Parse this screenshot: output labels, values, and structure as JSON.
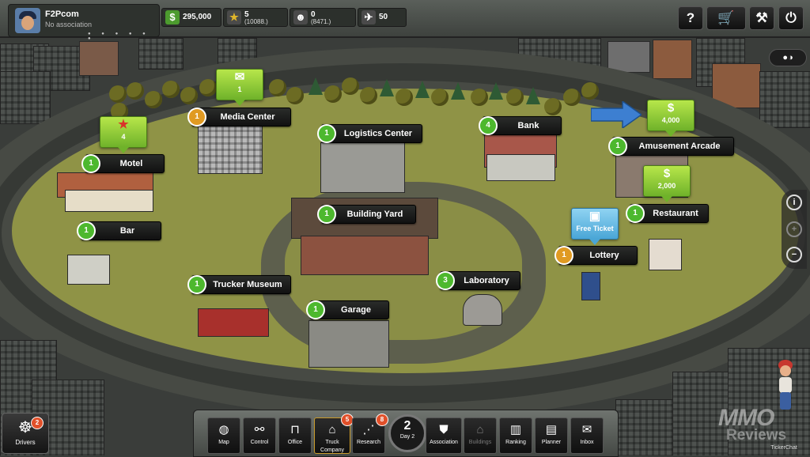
{
  "player": {
    "name": "F2Pcom",
    "association": "No association",
    "dots": "● ● ● ● ● ●"
  },
  "resources": {
    "cash": "295,000",
    "stars": "5",
    "stars_sub": "(10088.)",
    "reputation": "0",
    "reputation_sub": "(8471.)",
    "tickets": "50"
  },
  "top_buttons": {
    "help": "?",
    "shop": "🛒",
    "settings": "⚒",
    "power": "⏻"
  },
  "buildings": [
    {
      "name": "Media Center",
      "level": "1",
      "level_color": "orange"
    },
    {
      "name": "Logistics Center",
      "level": "1",
      "level_color": "green"
    },
    {
      "name": "Bank",
      "level": "4",
      "level_color": "green"
    },
    {
      "name": "Amusement Arcade",
      "level": "1",
      "level_color": "green"
    },
    {
      "name": "Motel",
      "level": "1",
      "level_color": "green"
    },
    {
      "name": "Bar",
      "level": "1",
      "level_color": "green"
    },
    {
      "name": "Building Yard",
      "level": "1",
      "level_color": "green"
    },
    {
      "name": "Restaurant",
      "level": "1",
      "level_color": "green"
    },
    {
      "name": "Lottery",
      "level": "1",
      "level_color": "orange"
    },
    {
      "name": "Trucker Museum",
      "level": "1",
      "level_color": "green"
    },
    {
      "name": "Laboratory",
      "level": "3",
      "level_color": "green"
    },
    {
      "name": "Garage",
      "level": "1",
      "level_color": "green"
    }
  ],
  "badges": {
    "media_center": "1",
    "motel": "4",
    "arcade": "4,000",
    "restaurant": "2,000",
    "lottery": "Free Ticket"
  },
  "side": {
    "toggle": "●◑",
    "info": "i",
    "zoom_in": "+",
    "zoom_out": "−"
  },
  "bottom_nav": [
    {
      "label": "Map",
      "icon": "◍"
    },
    {
      "label": "Control",
      "icon": "⚯"
    },
    {
      "label": "Office",
      "icon": "⊓"
    },
    {
      "label": "Truck Company",
      "icon": "⌂",
      "count": "5"
    },
    {
      "label": "Research",
      "icon": "⋰",
      "count": "8"
    },
    {
      "label": "Association",
      "icon": "⛊"
    },
    {
      "label": "Buildings",
      "icon": "⌂"
    },
    {
      "label": "Ranking",
      "icon": "▥"
    },
    {
      "label": "Planner",
      "icon": "▤"
    },
    {
      "label": "Inbox",
      "icon": "✉"
    }
  ],
  "day": {
    "number": "2",
    "label": "Day 2"
  },
  "drivers": {
    "label": "Drivers",
    "count": "2",
    "icon": "☸"
  },
  "ticker": {
    "label": "TickerChat"
  },
  "watermark": {
    "line1": "MMO",
    "line2": "Reviews"
  },
  "colors": {
    "field": "#8f9346",
    "road": "#363935",
    "label_bg": "#111111",
    "level_green": "#4db82e",
    "level_orange": "#e09a22"
  }
}
